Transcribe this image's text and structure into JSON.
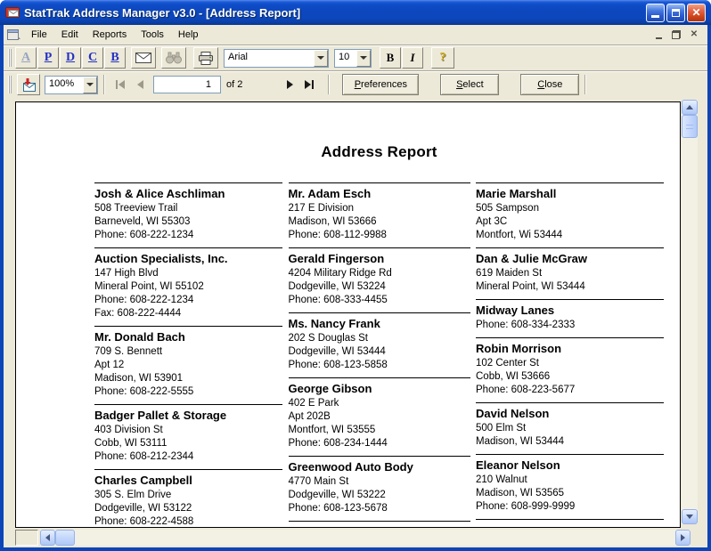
{
  "window": {
    "title": "StatTrak Address Manager v3.0 - [Address Report]",
    "app_icon": "envelope-app-icon",
    "controls": {
      "minimize": "minimize",
      "maximize": "maximize",
      "close": "close"
    }
  },
  "menu": {
    "items": [
      "File",
      "Edit",
      "Reports",
      "Tools",
      "Help"
    ],
    "child_controls": [
      "minimize",
      "restore",
      "close"
    ]
  },
  "format_toolbar": {
    "letter_buttons": [
      {
        "label": "A",
        "color": "#98A4C0"
      },
      {
        "label": "P",
        "color": "#2531C2"
      },
      {
        "label": "D",
        "color": "#2531C2"
      },
      {
        "label": "C",
        "color": "#2531C2"
      },
      {
        "label": "B",
        "color": "#2531C2"
      }
    ],
    "icons": [
      "envelope-icon",
      "binoculars-icon",
      "printer-icon"
    ],
    "font_name": "Arial",
    "font_size": "10",
    "bold_label": "B",
    "italic_label": "I",
    "help_label": "?"
  },
  "preview_bar": {
    "export_icon": "export-report-icon",
    "zoom_value": "100%",
    "page_number": "1",
    "page_count_label": "of 2",
    "buttons": {
      "preferences": "Preferences",
      "select": "Select",
      "close": "Close"
    }
  },
  "report": {
    "title": "Address Report",
    "columns": [
      {
        "trailing_rule": false,
        "entries": [
          {
            "name": "Josh & Alice Aschliman",
            "lines": [
              "508 Treeview Trail",
              "Barneveld, WI 55303",
              "Phone: 608-222-1234"
            ]
          },
          {
            "name": "Auction Specialists, Inc.",
            "lines": [
              "147 High Blvd",
              "Mineral Point, WI 55102",
              "Phone: 608-222-1234",
              "Fax: 608-222-4444"
            ]
          },
          {
            "name": "Mr. Donald Bach",
            "lines": [
              "709 S. Bennett",
              "Apt 12",
              "Madison, WI 53901",
              "Phone: 608-222-5555"
            ]
          },
          {
            "name": "Badger Pallet & Storage",
            "lines": [
              "403 Division St",
              "Cobb, WI 53111",
              "Phone: 608-212-2344"
            ]
          },
          {
            "name": "Charles Campbell",
            "lines": [
              "305 S. Elm Drive",
              "Dodgeville, WI 53122",
              "Phone: 608-222-4588"
            ]
          }
        ]
      },
      {
        "trailing_rule": true,
        "entries": [
          {
            "name": "Mr. Adam Esch",
            "lines": [
              "217 E Division",
              "Madison, WI 53666",
              "Phone: 608-112-9988"
            ]
          },
          {
            "name": "Gerald Fingerson",
            "lines": [
              "4204 Military Ridge Rd",
              "Dodgeville, WI 53224",
              "Phone: 608-333-4455"
            ]
          },
          {
            "name": "Ms. Nancy Frank",
            "lines": [
              "202 S Douglas St",
              "Dodgeville, WI 53444",
              "Phone: 608-123-5858"
            ]
          },
          {
            "name": "George Gibson",
            "lines": [
              "402 E Park",
              "Apt 202B",
              "Montfort, WI 53555",
              "Phone: 608-234-1444"
            ]
          },
          {
            "name": "Greenwood Auto Body",
            "lines": [
              "4770 Main St",
              "Dodgeville, WI 53222",
              "Phone: 608-123-5678"
            ]
          }
        ]
      },
      {
        "trailing_rule": true,
        "entries": [
          {
            "name": "Marie Marshall",
            "lines": [
              "505 Sampson",
              "Apt 3C",
              "Montfort, Wi 53444"
            ]
          },
          {
            "name": "Dan & Julie McGraw",
            "lines": [
              "619 Maiden St",
              "Mineral Point, WI 53444"
            ]
          },
          {
            "name": "Midway Lanes",
            "lines": [
              "Phone: 608-334-2333"
            ]
          },
          {
            "name": "Robin Morrison",
            "lines": [
              "102 Center St",
              "Cobb, WI 53666",
              "Phone: 608-223-5677"
            ]
          },
          {
            "name": "David Nelson",
            "lines": [
              "500 Elm St",
              "Madison, WI 53444"
            ]
          },
          {
            "name": "Eleanor Nelson",
            "lines": [
              "210 Walnut",
              "Madison, WI 53565",
              "Phone: 608-999-9999"
            ]
          }
        ]
      }
    ]
  },
  "colors": {
    "titlebar_blue": "#0D47BE",
    "close_red": "#D4491F",
    "chrome": "#ECE9D8",
    "scrollbar_blue": "#C4D8FB"
  }
}
